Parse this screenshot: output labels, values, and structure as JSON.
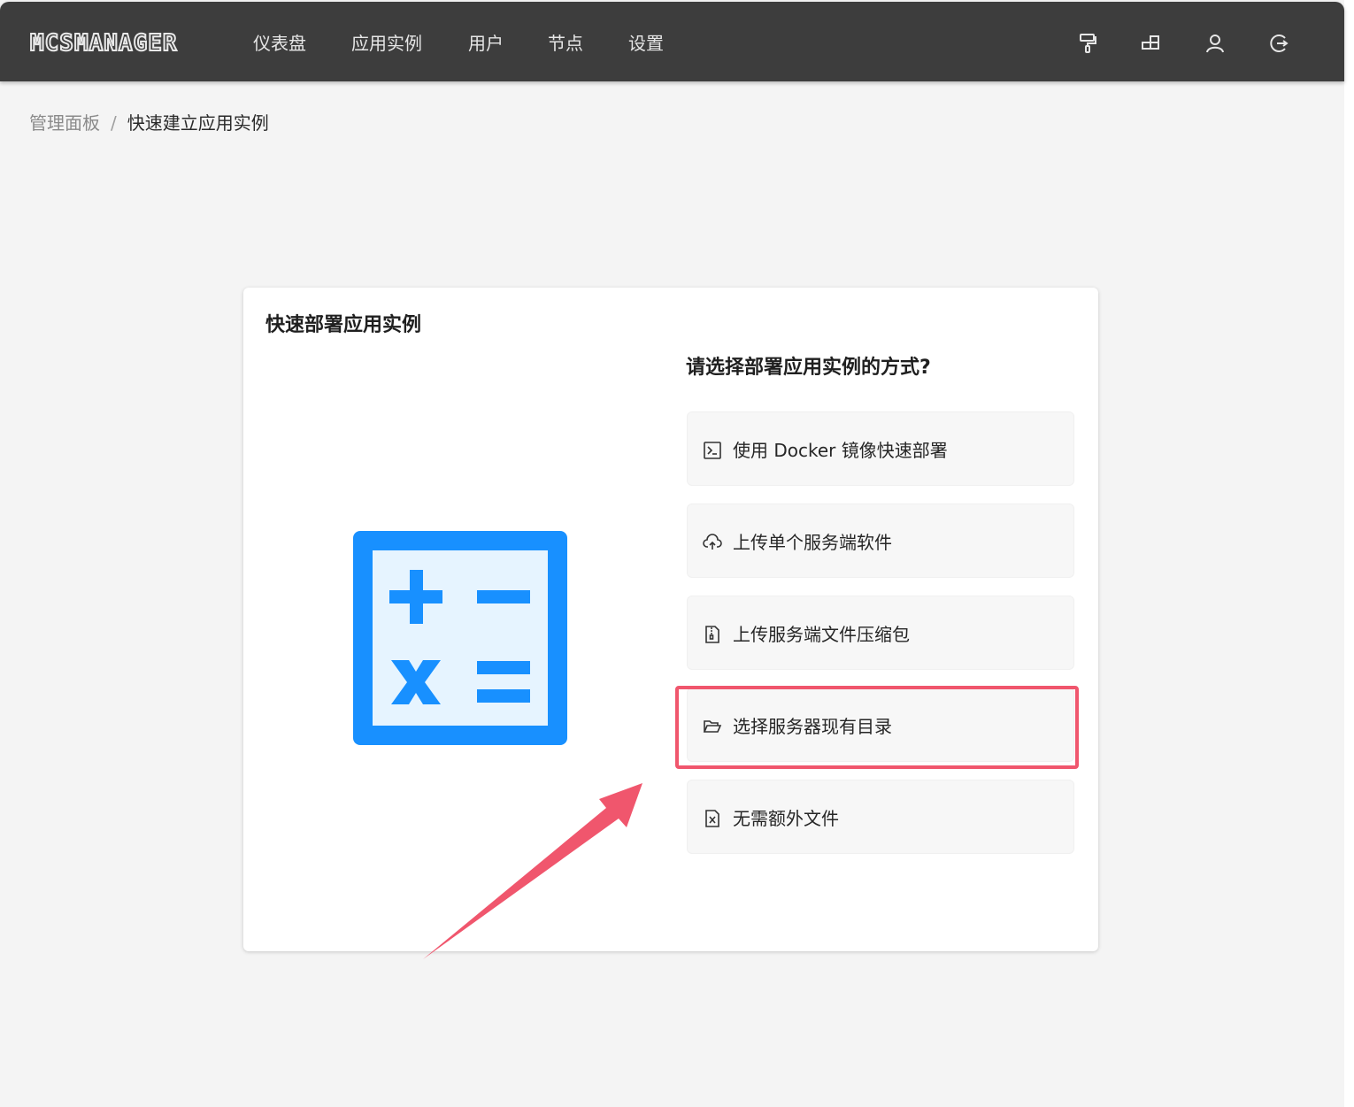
{
  "app": {
    "logo_text": "MCSMANAGER",
    "nav": [
      "仪表盘",
      "应用实例",
      "用户",
      "节点",
      "设置"
    ],
    "top_icons": [
      "paint-roller-icon",
      "layout-blocks-icon",
      "user-icon",
      "logout-icon"
    ]
  },
  "breadcrumb": {
    "root": "管理面板",
    "separator": "/",
    "current": "快速建立应用实例"
  },
  "card": {
    "title": "快速部署应用实例",
    "question": "请选择部署应用实例的方式?",
    "illustration_icon": "calculator-icon",
    "options": [
      {
        "label": "使用 Docker 镜像快速部署",
        "icon": "terminal-icon"
      },
      {
        "label": "上传单个服务端软件",
        "icon": "cloud-upload-icon"
      },
      {
        "label": "上传服务端文件压缩包",
        "icon": "file-zip-icon"
      },
      {
        "label": "选择服务器现有目录",
        "icon": "folder-open-icon"
      },
      {
        "label": "无需额外文件",
        "icon": "file-excel-icon"
      }
    ],
    "highlighted_option": "选择服务器现有目录"
  },
  "colors": {
    "topbar": "#3d3d3d",
    "page_bg": "#f4f4f4",
    "illustration_blue": "#1890ff",
    "illustration_fill": "#e6f4ff",
    "annotation_red": "#f0566d"
  }
}
